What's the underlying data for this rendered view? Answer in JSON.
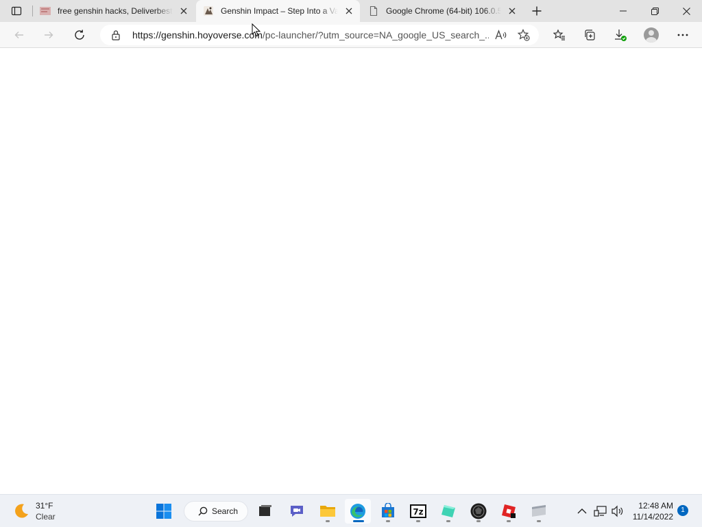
{
  "tabs": [
    {
      "title": "free genshin hacks, Deliverbestre",
      "icon": "thumbnail-favicon-icon"
    },
    {
      "title": "Genshin Impact – Step Into a Vast",
      "icon": "genshin-favicon-icon",
      "active": true
    },
    {
      "title": "Google Chrome (64-bit) 106.0.52",
      "icon": "document-icon"
    }
  ],
  "address_bar": {
    "url_host": "https://genshin.hoyoverse.com",
    "url_path": "/pc-launcher/?utm_source=NA_google_US_search_..."
  },
  "taskbar": {
    "weather": {
      "temp": "31°F",
      "condition": "Clear"
    },
    "search_label": "Search",
    "clock": {
      "time": "12:48 AM",
      "date": "11/14/2022"
    },
    "notification_count": "1"
  },
  "colors": {
    "accent": "#0067c0",
    "tabstrip_bg": "#e3e3e3",
    "toolbar_bg": "#f7f7f7",
    "taskbar_bg": "#eef1f6"
  }
}
